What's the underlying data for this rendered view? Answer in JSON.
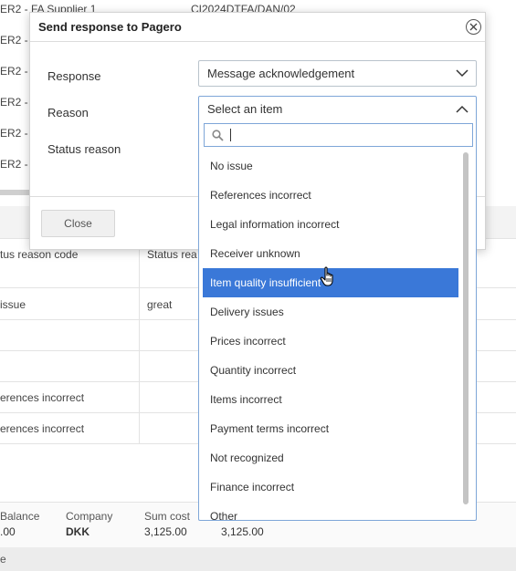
{
  "background": {
    "top_rows": [
      {
        "left": "ER2 - FA Supplier 1",
        "right": "CI2024DTFA/DAN/02"
      },
      {
        "left": "ER2 - F"
      },
      {
        "left": "ER2 - F"
      },
      {
        "left": "ER2 - F"
      },
      {
        "left": "ER2 - F"
      },
      {
        "left": "ER2 - F"
      }
    ],
    "table_headers": {
      "col1": "tus reason code",
      "col2": "Status rea"
    },
    "table_rows": [
      {
        "col1": "issue",
        "col2": "great"
      },
      {
        "col1": "",
        "col2": ""
      },
      {
        "col1": "",
        "col2": ""
      },
      {
        "col1": "erences incorrect",
        "col2": ""
      },
      {
        "col1": "erences incorrect",
        "col2": ""
      }
    ],
    "footer": {
      "balance_label": "Balance",
      "balance_value": ".00",
      "company_label": "Company",
      "company_value": "DKK",
      "sumcost_label": "Sum cost",
      "sumcost_value": "3,125.00",
      "extra_value": "3,125.00"
    },
    "status_strip_text": "e",
    "colors": {
      "accent_green": "#27a36a"
    }
  },
  "dialog": {
    "title": "Send response to Pagero",
    "close_icon": "close-circle-icon",
    "fields": {
      "response_label": "Response",
      "response_value": "Message acknowledgement",
      "reason_label": "Reason",
      "status_reason_label": "Status reason"
    },
    "close_button": "Close"
  },
  "dropdown": {
    "placeholder": "Select an item",
    "search_value": "",
    "selected_index": 4,
    "items": [
      "No issue",
      "References incorrect",
      "Legal information incorrect",
      "Receiver unknown",
      "Item quality insufficient",
      "Delivery issues",
      "Prices incorrect",
      "Quantity incorrect",
      "Items incorrect",
      "Payment terms incorrect",
      "Not recognized",
      "Finance incorrect",
      "Other"
    ],
    "colors": {
      "selected_bg": "#3a78d8",
      "border": "#7ea6d8"
    }
  }
}
